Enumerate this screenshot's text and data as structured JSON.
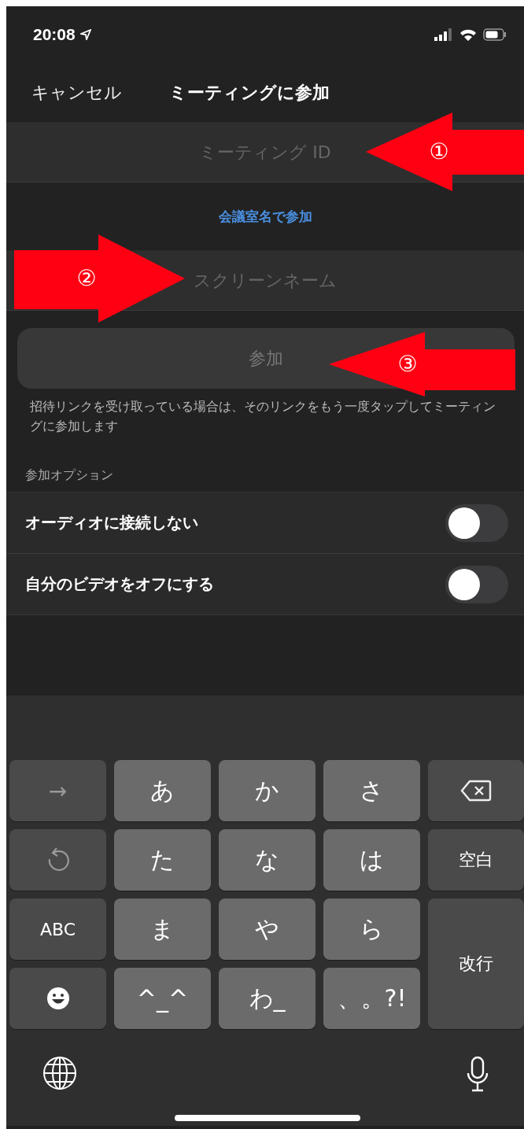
{
  "status_bar": {
    "time": "20:08"
  },
  "nav": {
    "cancel": "キャンセル",
    "title": "ミーティングに参加"
  },
  "meeting_id_field": {
    "placeholder": "ミーティング ID"
  },
  "room_link": "会議室名で参加",
  "screen_name_field": {
    "placeholder": "スクリーンネーム"
  },
  "join_button": {
    "label": "参加",
    "disabled": true
  },
  "hint": "招待リンクを受け取っている場合は、そのリンクをもう一度タップしてミーティングに参加します",
  "options_header": "参加オプション",
  "options": [
    {
      "label": "オーディオに接続しない",
      "on": false
    },
    {
      "label": "自分のビデオをオフにする",
      "on": false
    }
  ],
  "keyboard": {
    "keys": [
      {
        "kind": "arrow",
        "label": "→"
      },
      {
        "kind": "char",
        "label": "あ"
      },
      {
        "kind": "char",
        "label": "か"
      },
      {
        "kind": "char",
        "label": "さ"
      },
      {
        "kind": "delete"
      },
      {
        "kind": "undo"
      },
      {
        "kind": "char",
        "label": "た"
      },
      {
        "kind": "char",
        "label": "な"
      },
      {
        "kind": "char",
        "label": "は"
      },
      {
        "kind": "function",
        "label": "空白"
      },
      {
        "kind": "function",
        "label": "ABC"
      },
      {
        "kind": "char",
        "label": "ま"
      },
      {
        "kind": "char",
        "label": "や"
      },
      {
        "kind": "char",
        "label": "ら"
      },
      {
        "kind": "enter",
        "label": "改行"
      },
      {
        "kind": "emoji"
      },
      {
        "kind": "char",
        "label": "^_^"
      },
      {
        "kind": "char",
        "label": "わ_"
      },
      {
        "kind": "char",
        "label": "、。?!"
      }
    ]
  },
  "annotations": [
    {
      "label": "①",
      "kind": "left"
    },
    {
      "label": "②",
      "kind": "right"
    },
    {
      "label": "③",
      "kind": "left"
    }
  ]
}
